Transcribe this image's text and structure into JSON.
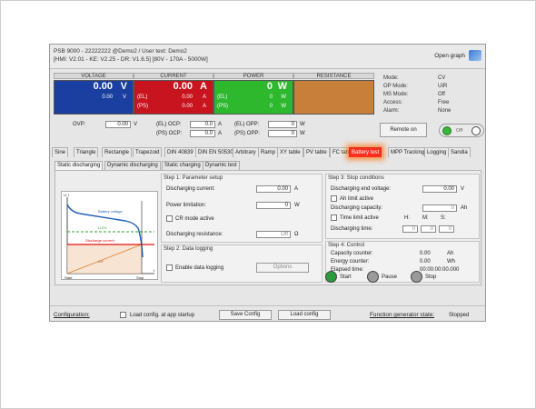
{
  "header": {
    "line1": "PSB 9000 - 22222222 @Demo2 / User text: Demo2",
    "line2": "[HMI: V2.01 - KE: V2.25 - DR: V1.6.5] [80V - 170A - 5000W]",
    "open_graph": "Open graph"
  },
  "meters": {
    "voltage": {
      "label": "VOLTAGE",
      "big": "0.00",
      "unit": "V",
      "set": "0.00",
      "set_unit": "V",
      "color": "#1a3fa0"
    },
    "current": {
      "label": "CURRENT",
      "big": "0.00",
      "unit": "A",
      "el": "(EL)",
      "el_val": "0.00",
      "el_unit": "A",
      "ps": "(PS)",
      "ps_val": "0.00",
      "ps_unit": "A",
      "color": "#c8141e"
    },
    "power": {
      "label": "POWER",
      "big": "0",
      "unit": "W",
      "el": "(EL)",
      "el_val": "0",
      "el_unit": "W",
      "ps": "(PS)",
      "ps_val": "0",
      "ps_unit": "W",
      "color": "#2db82d"
    },
    "resistance": {
      "label": "RESISTANCE",
      "color": "#c87f3a"
    }
  },
  "status": [
    {
      "k": "Mode:",
      "v": "CV"
    },
    {
      "k": "OP Mode:",
      "v": "UIR"
    },
    {
      "k": "MS Mode:",
      "v": "Off"
    },
    {
      "k": "Access:",
      "v": "Free"
    },
    {
      "k": "Alarm:",
      "v": "None"
    }
  ],
  "protection": {
    "ovp_label": "OVP:",
    "ovp_val": "0.00",
    "ovp_unit": "V",
    "el_ocp_label": "(EL) OCP:",
    "el_ocp_val": "0.0",
    "el_ocp_unit": "A",
    "ps_ocp_label": "(PS) OCP:",
    "ps_ocp_val": "0.0",
    "ps_ocp_unit": "A",
    "el_opp_label": "(EL) OPP:",
    "el_opp_val": "0",
    "el_opp_unit": "W",
    "ps_opp_label": "(PS) OPP:",
    "ps_opp_val": "0",
    "ps_opp_unit": "W"
  },
  "remote_button": "Remote on",
  "toggle_label": "Off",
  "tabs": [
    "Sine",
    "Triangle",
    "Rectangle",
    "Trapezoid",
    "DIN 40839",
    "DIN EN 50530",
    "Arbitrary",
    "Ramp",
    "XY table",
    "PV table",
    "FC tab",
    "Battery test",
    "MPP Tracking",
    "Logging",
    "Sandia"
  ],
  "subtabs": [
    "Static discharging",
    "Dynamic discharging",
    "Static charging",
    "Dynamic test"
  ],
  "graph": {
    "uc": "U, I",
    "battery_voltage": "Battery voltage",
    "u_dv": "U-DV",
    "discharge_current": "Discharge current",
    "ah": "AH",
    "start": "Start",
    "stop": "Stop",
    "t": "t"
  },
  "step1": {
    "title": "Step 1: Parameter setup",
    "dis_current_label": "Discharging current:",
    "dis_current_val": "0.00",
    "dis_current_unit": "A",
    "power_label": "Power limitation:",
    "power_val": "0",
    "power_unit": "W",
    "cr_label": "CR mode active",
    "dis_res_label": "Discharging resistance:",
    "dis_res_val": "Off",
    "dis_res_unit": "Ω"
  },
  "step2": {
    "title": "Step 2: Data logging",
    "enable_label": "Enable data logging",
    "options_button": "Options"
  },
  "step3": {
    "title": "Step 3: Stop conditions",
    "end_voltage_label": "Discharging end voltage:",
    "end_voltage_val": "0.00",
    "end_voltage_unit": "V",
    "ah_limit_label": "Ah limit active",
    "capacity_label": "Discharging capacity:",
    "capacity_val": "0",
    "capacity_unit": "Ah",
    "time_limit_label": "Time limit active",
    "h": "H:",
    "m": "M:",
    "s": "S:",
    "dis_time_label": "Discharging time:",
    "h_val": "0",
    "m_val": "0",
    "s_val": "0"
  },
  "step4": {
    "title": "Step 4: Control",
    "cap_counter_label": "Capacity counter:",
    "cap_counter_val": "0.00",
    "cap_counter_unit": "Ah",
    "energy_label": "Energy counter:",
    "energy_val": "0.00",
    "energy_unit": "Wh",
    "elapsed_label": "Elapsed time:",
    "elapsed_val": "00:00:00:00.000",
    "start": "Start",
    "pause": "Pause",
    "stop": "Stop"
  },
  "footer": {
    "configuration": "Configuration:",
    "load_startup": "Load config. at app startup",
    "save_config": "Save Config",
    "load_config": "Load config",
    "fg_state_label": "Function generator state:",
    "fg_state_val": "Stopped"
  }
}
